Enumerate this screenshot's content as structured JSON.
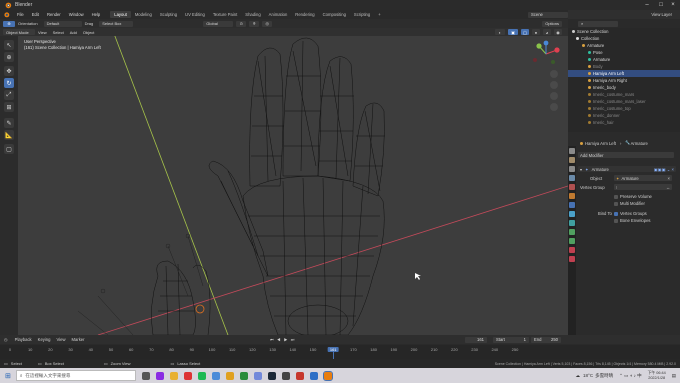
{
  "app": {
    "title": "Blender"
  },
  "menus": [
    "File",
    "Edit",
    "Render",
    "Window",
    "Help"
  ],
  "workspaces": [
    "Layout",
    "Modeling",
    "Sculpting",
    "UV Editing",
    "Texture Paint",
    "Shading",
    "Animation",
    "Rendering",
    "Compositing",
    "Scripting"
  ],
  "active_workspace": "Layout",
  "topbar": {
    "add_ws": "+",
    "scene": "Scene",
    "view_layer": "View Layer"
  },
  "header2": {
    "orientation": "Orientation",
    "default": "Default",
    "drag": "Drag",
    "select_box": "Select Box",
    "global": "Global",
    "options": "Options"
  },
  "header3": {
    "mode": "Object Mode",
    "view": "View",
    "select": "Select",
    "add": "Add",
    "object": "Object"
  },
  "viewport": {
    "perspective": "User Perspective",
    "collection": "(161) Scene Collection | Hamiya Arm Left"
  },
  "outliner": {
    "root": "Scene Collection",
    "items": [
      {
        "label": "Collection",
        "dim": false,
        "sel": false
      },
      {
        "label": "Armature",
        "dim": false,
        "sel": false
      },
      {
        "label": "Pose",
        "dim": false,
        "sel": false
      },
      {
        "label": "Armature",
        "dim": false,
        "sel": false
      },
      {
        "label": "Body",
        "dim": true,
        "sel": false
      },
      {
        "label": "Hamiya Arm Left",
        "dim": false,
        "sel": true
      },
      {
        "label": "Hamiya Arm Right",
        "dim": false,
        "sel": false
      },
      {
        "label": "Imeric_body",
        "dim": false,
        "sel": false
      },
      {
        "label": "Imeric_costume_mars",
        "dim": true,
        "sel": false
      },
      {
        "label": "Imeric_costume_mars_laser",
        "dim": true,
        "sel": false
      },
      {
        "label": "Imeric_costume_top",
        "dim": true,
        "sel": false
      },
      {
        "label": "Imeric_donner",
        "dim": true,
        "sel": false
      },
      {
        "label": "Imeric_hair",
        "dim": true,
        "sel": false
      }
    ]
  },
  "props": {
    "breadcrumb_obj": "Hamiya Arm Left",
    "breadcrumb_mod": "Armature",
    "add_modifier": "Add Modifier",
    "modifier_name": "Armature",
    "object_label": "Object",
    "object_value": "Armature",
    "vgroup_label": "Vertex Group",
    "preserve_volume": "Preserve Volume",
    "multi_modifier": "Multi Modifier",
    "bind_to": "Bind To",
    "vertex_groups": "Vertex Groups",
    "bone_envelopes": "Bone Envelopes"
  },
  "timeline": {
    "playback": "Playback",
    "keying": "Keying",
    "view": "View",
    "marker": "Marker",
    "current_frame": "161",
    "start_label": "Start",
    "start": "1",
    "end_label": "End",
    "end": "250",
    "ticks": [
      "0",
      "10",
      "20",
      "30",
      "40",
      "50",
      "60",
      "70",
      "80",
      "90",
      "100",
      "110",
      "120",
      "130",
      "140",
      "150",
      "161",
      "170",
      "180",
      "190",
      "200",
      "210",
      "220",
      "230",
      "240",
      "250"
    ]
  },
  "statusbar": {
    "select": "Select",
    "box_select": "Box Select",
    "zoom_view": "Zoom View",
    "lasso_select": "Lasso Select",
    "stats": "Scene Collection | Hamiya Arm Left | Verts 5,103 | Faces 8,156 | Tris 8,145 | Objects 1/4 | Memory 580.4 MiB | 2.92.0"
  },
  "taskbar": {
    "search_placeholder": "在這裡輸入文字來搜尋",
    "temperature": "18°C",
    "weather": "多雲時晴",
    "time": "下午 06:44",
    "date": "2022/1/28"
  },
  "colors": {
    "accent": "#4772b3",
    "selected_row": "#334d80",
    "playhead": "#4772b3"
  }
}
